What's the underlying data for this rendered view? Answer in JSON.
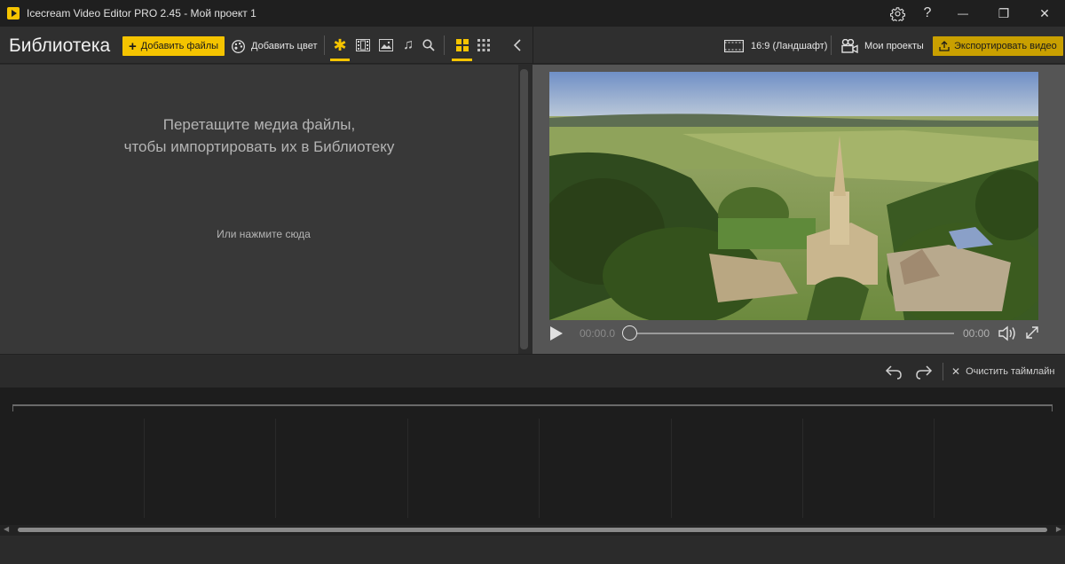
{
  "window": {
    "title": "Icecream Video Editor PRO 2.45  - Мой проект 1",
    "settings_icon": "gear-icon",
    "help_label": "?",
    "minimize_label": "—",
    "restore_label": "❐",
    "close_label": "✕"
  },
  "library": {
    "title": "Библиотека",
    "add_files_label": "Добавить файлы",
    "add_color_label": "Добавить цвет",
    "filters": [
      "star-icon",
      "film-icon",
      "image-icon",
      "music-icon",
      "search-icon"
    ],
    "views": [
      "grid-large-icon",
      "grid-small-icon"
    ],
    "collapse_icon": "chevron-left-icon",
    "drop_line1": "Перетащите медиа файлы,",
    "drop_line2": "чтобы импортировать их в Библиотеку",
    "drop_sub": "Или нажмите сюда"
  },
  "header_right": {
    "aspect_label": "16:9 (Ландшафт)",
    "projects_label": "Мои проекты",
    "export_label": "Экспортировать видео"
  },
  "player": {
    "current_time": "00:00.0",
    "total_time": "00:00",
    "progress": 0
  },
  "timeline": {
    "clear_label": "Очистить таймлайн"
  },
  "colors": {
    "accent": "#f5c400",
    "panel_dark": "#383838",
    "preview_bg": "#555555",
    "timeline_bg": "#1d1d1d"
  }
}
